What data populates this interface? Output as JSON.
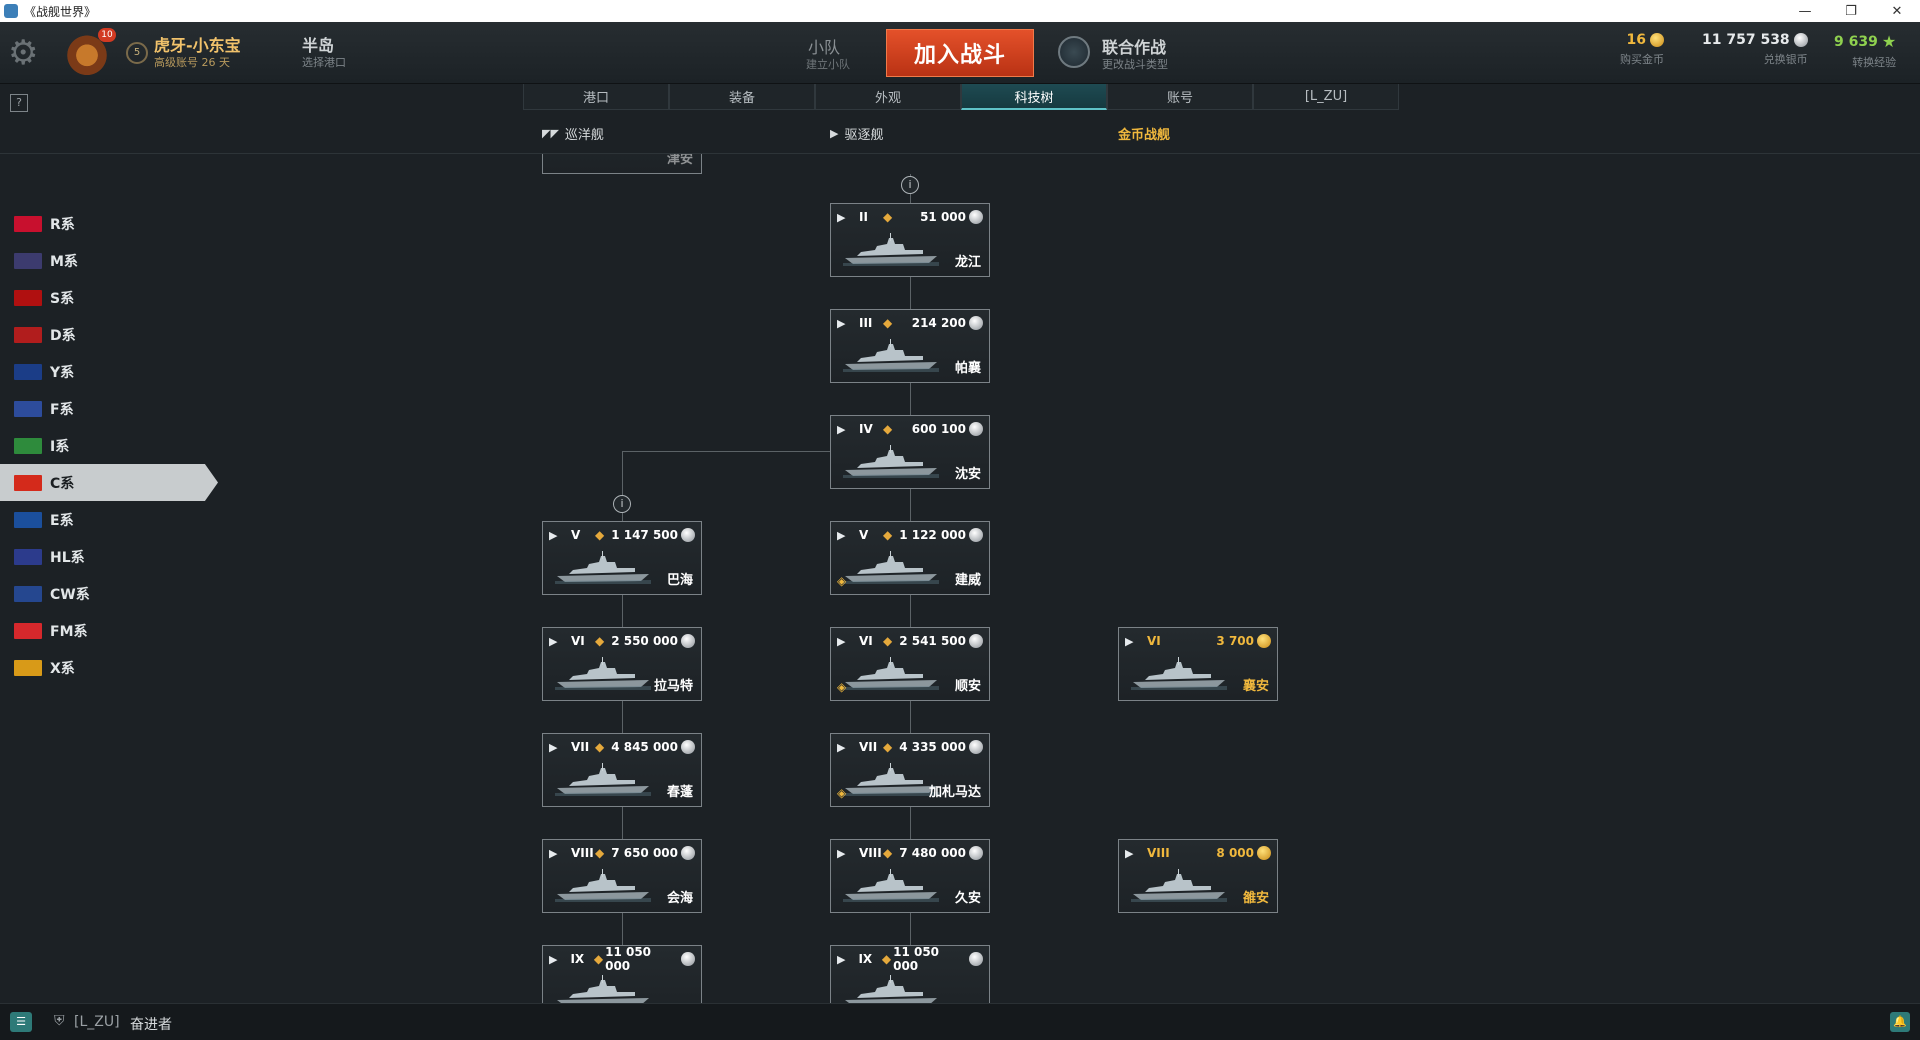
{
  "window": {
    "title": "《战舰世界》",
    "controls": [
      "—",
      "❐",
      "✕"
    ]
  },
  "header": {
    "rank_badge": "10",
    "level": "5",
    "player_name": "虎牙-小东宝",
    "account_status": "高级账号 26 天",
    "port_name": "半岛",
    "port_select": "选择港口",
    "squad_label": "小队",
    "squad_sub": "建立小队",
    "battle_button": "加入战斗",
    "mode_label": "联合作战",
    "mode_sub": "更改战斗类型",
    "gold": {
      "amount": "16",
      "label": "购买金币"
    },
    "credits": {
      "amount": "11 757 538",
      "label": "兑换银币"
    },
    "free_xp": {
      "amount": "9 639",
      "label": "转换经验"
    }
  },
  "help_button": "?",
  "tabs": [
    {
      "label": "港口"
    },
    {
      "label": "装备"
    },
    {
      "label": "外观"
    },
    {
      "label": "科技树",
      "active": true
    },
    {
      "label": "账号"
    },
    {
      "label": "[L_ZU]"
    }
  ],
  "filters": {
    "cruisers": "巡洋舰",
    "destroyers": "驱逐舰",
    "premium": "金币战舰"
  },
  "nations": [
    {
      "label": "R系",
      "flag": "#c8102e"
    },
    {
      "label": "M系",
      "flag": "#3c3b6e"
    },
    {
      "label": "S系",
      "flag": "#b01010"
    },
    {
      "label": "D系",
      "flag": "#b11d1d"
    },
    {
      "label": "Y系",
      "flag": "#1b3d87"
    },
    {
      "label": "F系",
      "flag": "#2d4c9c"
    },
    {
      "label": "I系",
      "flag": "#2e8b3c"
    },
    {
      "label": "C系",
      "flag": "#d42a1b",
      "active": true
    },
    {
      "label": "E系",
      "flag": "#1b4f9c"
    },
    {
      "label": "HL系",
      "flag": "#2c3b8c"
    },
    {
      "label": "CW系",
      "flag": "#25478f"
    },
    {
      "label": "FM系",
      "flag": "#d6282c"
    },
    {
      "label": "X系",
      "flag": "#d89a18"
    }
  ],
  "tree": {
    "top_partial_name": "津安",
    "info_icon": "i",
    "ships": [
      {
        "cls": "▶",
        "tier": "II",
        "price": "51 000",
        "currency": "silver",
        "name": "龙江",
        "col": 1,
        "row": 0
      },
      {
        "cls": "▶",
        "tier": "III",
        "price": "214 200",
        "currency": "silver",
        "name": "帕襄",
        "col": 1,
        "row": 1
      },
      {
        "cls": "▶",
        "tier": "IV",
        "price": "600 100",
        "currency": "silver",
        "name": "沈安",
        "col": 1,
        "row": 2
      },
      {
        "cls": "▶",
        "tier": "V",
        "price": "1 147 500",
        "currency": "silver",
        "name": "巴海",
        "col": 0,
        "row": 3
      },
      {
        "cls": "▶",
        "tier": "V",
        "price": "1 122 000",
        "currency": "silver",
        "name": "建威",
        "col": 1,
        "row": 3,
        "elite": true
      },
      {
        "cls": "▶",
        "tier": "VI",
        "price": "2 550 000",
        "currency": "silver",
        "name": "拉马特",
        "col": 0,
        "row": 4
      },
      {
        "cls": "▶",
        "tier": "VI",
        "price": "2 541 500",
        "currency": "silver",
        "name": "顺安",
        "col": 1,
        "row": 4,
        "elite": true
      },
      {
        "cls": "▶",
        "tier": "VI",
        "price": "3 700",
        "currency": "gold",
        "name": "襄安",
        "col": 2,
        "row": 4,
        "premium": true
      },
      {
        "cls": "▶",
        "tier": "VII",
        "price": "4 845 000",
        "currency": "silver",
        "name": "春蓬",
        "col": 0,
        "row": 5
      },
      {
        "cls": "▶",
        "tier": "VII",
        "price": "4 335 000",
        "currency": "silver",
        "name": "加札马达",
        "col": 1,
        "row": 5,
        "elite": true
      },
      {
        "cls": "▶",
        "tier": "VIII",
        "price": "7 650 000",
        "currency": "silver",
        "name": "会海",
        "col": 0,
        "row": 6
      },
      {
        "cls": "▶",
        "tier": "VIII",
        "price": "7 480 000",
        "currency": "silver",
        "name": "久安",
        "col": 1,
        "row": 6
      },
      {
        "cls": "▶",
        "tier": "VIII",
        "price": "8 000",
        "currency": "gold",
        "name": "雒安",
        "col": 2,
        "row": 6,
        "premium": true
      },
      {
        "cls": "▶",
        "tier": "IX",
        "price": "11 050 000",
        "currency": "silver",
        "name": "",
        "col": 0,
        "row": 7
      },
      {
        "cls": "▶",
        "tier": "IX",
        "price": "11 050 000",
        "currency": "silver",
        "name": "",
        "col": 1,
        "row": 7
      }
    ]
  },
  "bottom": {
    "chat_icon": "☰",
    "clan_tag": "[L_ZU]",
    "clan_rank": "奋进者",
    "bell_icon": "🔔"
  }
}
